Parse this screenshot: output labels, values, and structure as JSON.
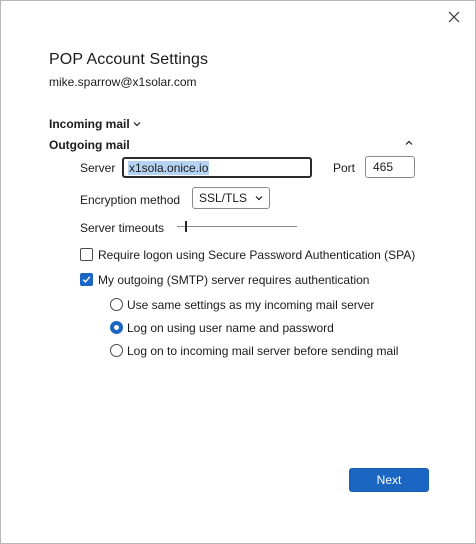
{
  "dialog": {
    "title": "POP Account Settings",
    "email": "mike.sparrow@x1solar.com"
  },
  "incoming": {
    "label": "Incoming mail",
    "expanded": false
  },
  "outgoing": {
    "label": "Outgoing mail",
    "expanded": true,
    "server_label": "Server",
    "server_value": "x1sola.onice.io",
    "port_label": "Port",
    "port_value": "465",
    "encryption_label": "Encryption method",
    "encryption_value": "SSL/TLS",
    "timeout_label": "Server timeouts",
    "timeout_level": 0.07,
    "spa_label": "Require logon using Secure Password Authentication (SPA)",
    "spa_checked": false,
    "smtp_auth_label": "My outgoing (SMTP) server requires authentication",
    "smtp_auth_checked": true,
    "auth_options": [
      {
        "label": "Use same settings as my incoming mail server",
        "selected": false
      },
      {
        "label": "Log on using user name and password",
        "selected": true
      },
      {
        "label": "Log on to incoming mail server before sending mail",
        "selected": false
      }
    ]
  },
  "buttons": {
    "next_label": "Next"
  },
  "icons": {
    "close": "close-icon",
    "chevron_down": "chevron-down-icon",
    "chevron_up": "chevron-up-icon",
    "dropdown": "dropdown-chevron-icon",
    "check": "checkmark-icon"
  },
  "colors": {
    "accent": "#1a66c2",
    "selection": "#b5d4f3"
  }
}
